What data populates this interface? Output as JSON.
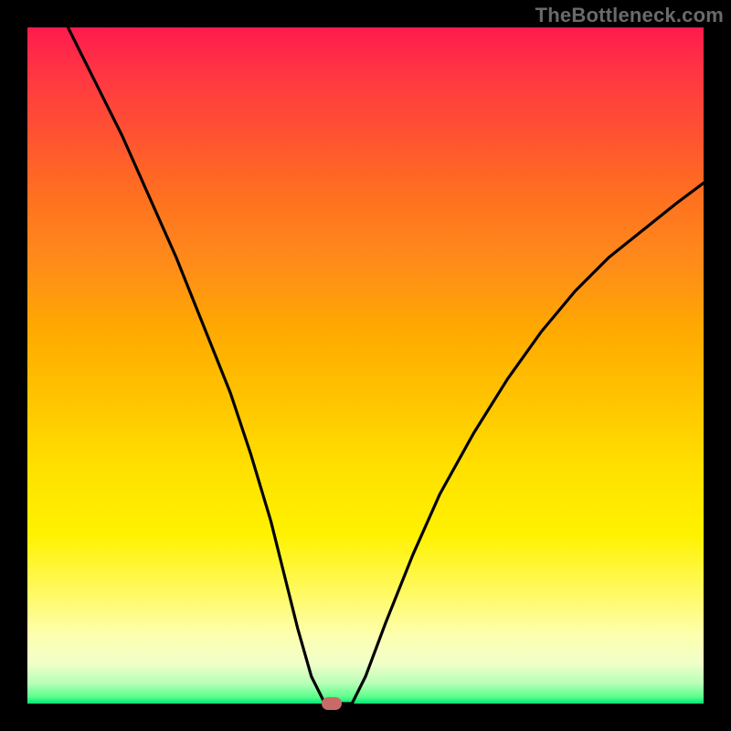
{
  "watermark": "TheBottleneck.com",
  "colors": {
    "frame": "#000000",
    "gradient_top": "#ff1a4d",
    "gradient_bottom": "#00e676",
    "curve": "#000000",
    "marker": "#c96a6a",
    "watermark_text": "#6a6a6a"
  },
  "chart_data": {
    "type": "line",
    "title": "",
    "xlabel": "",
    "ylabel": "",
    "xlim": [
      0,
      100
    ],
    "ylim": [
      0,
      100
    ],
    "series": [
      {
        "name": "bottleneck-curve",
        "x": [
          6,
          10,
          14,
          18,
          22,
          26,
          30,
          33,
          36,
          38,
          40,
          42,
          44,
          45,
          48,
          50,
          53,
          57,
          61,
          66,
          71,
          76,
          81,
          86,
          91,
          96,
          100
        ],
        "values": [
          100,
          92,
          84,
          75,
          66,
          56,
          46,
          37,
          27,
          19,
          11,
          4,
          0,
          0,
          0,
          4,
          12,
          22,
          31,
          40,
          48,
          55,
          61,
          66,
          70,
          74,
          77
        ]
      }
    ],
    "marker": {
      "x": 45,
      "y": 0
    },
    "grid": false,
    "legend": false
  }
}
